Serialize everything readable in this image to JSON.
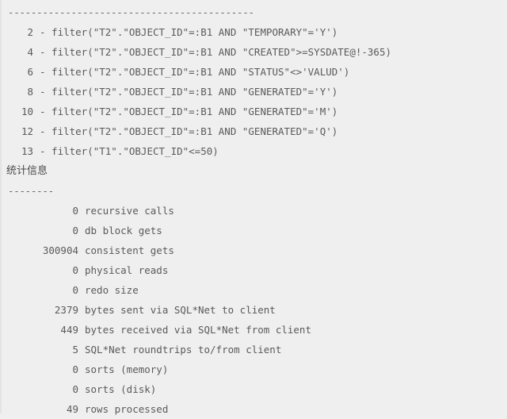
{
  "terminal": {
    "top_separator": "-------------------------------------------",
    "predicate_rows": [
      {
        "id": "2",
        "text": "- filter(\"T2\".\"OBJECT_ID\"=:B1 AND \"TEMPORARY\"='Y')"
      },
      {
        "id": "4",
        "text": "- filter(\"T2\".\"OBJECT_ID\"=:B1 AND \"CREATED\">=SYSDATE@!-365)"
      },
      {
        "id": "6",
        "text": "- filter(\"T2\".\"OBJECT_ID\"=:B1 AND \"STATUS\"<>'VALUD')"
      },
      {
        "id": "8",
        "text": "- filter(\"T2\".\"OBJECT_ID\"=:B1 AND \"GENERATED\"='Y')"
      },
      {
        "id": "10",
        "text": "- filter(\"T2\".\"OBJECT_ID\"=:B1 AND \"GENERATED\"='M')"
      },
      {
        "id": "12",
        "text": "- filter(\"T2\".\"OBJECT_ID\"=:B1 AND \"GENERATED\"='Q')"
      },
      {
        "id": "13",
        "text": "- filter(\"T1\".\"OBJECT_ID\"<=50)"
      }
    ],
    "statistics_heading": "统计信息",
    "statistics_separator": "--------",
    "statistics": [
      {
        "value": "0",
        "label": "recursive calls"
      },
      {
        "value": "0",
        "label": "db block gets"
      },
      {
        "value": "300904",
        "label": "consistent gets"
      },
      {
        "value": "0",
        "label": "physical reads"
      },
      {
        "value": "0",
        "label": "redo size"
      },
      {
        "value": "2379",
        "label": "bytes sent via SQL*Net to client"
      },
      {
        "value": "449",
        "label": "bytes received via SQL*Net from client"
      },
      {
        "value": "5",
        "label": "SQL*Net roundtrips to/from client"
      },
      {
        "value": "0",
        "label": "sorts (memory)"
      },
      {
        "value": "0",
        "label": "sorts (disk)"
      },
      {
        "value": "49",
        "label": "rows processed"
      }
    ]
  }
}
